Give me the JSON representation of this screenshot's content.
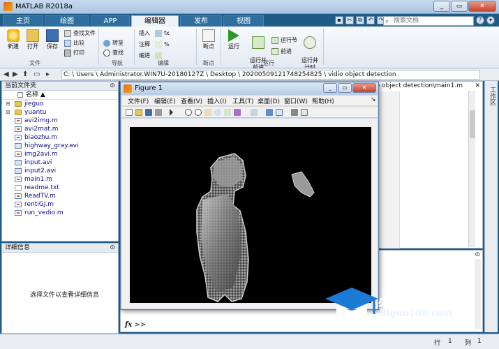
{
  "window": {
    "title": "MATLAB R2018a"
  },
  "tabs": [
    {
      "label": "主页"
    },
    {
      "label": "绘图"
    },
    {
      "label": "APP"
    },
    {
      "label": "编辑器"
    },
    {
      "label": "发布"
    },
    {
      "label": "视图"
    }
  ],
  "search": {
    "placeholder": "搜索文档"
  },
  "ribbon": {
    "new": "新建",
    "open": "打开",
    "save": "保存",
    "find_files": "查找文件",
    "compare": "比较",
    "print": "打印",
    "goto": "转至",
    "find": "查找",
    "insert": "插入",
    "comment": "注释",
    "indent": "缩进",
    "breakpoints": "断点",
    "run": "运行",
    "run_advance": "运行并\n前进",
    "run_section": "运行节",
    "advance": "前进",
    "run_time": "运行并\n计时",
    "group_file": "文件",
    "group_nav": "导航",
    "group_edit": "编辑",
    "group_bp": "断点",
    "group_run": "运行"
  },
  "address": {
    "path": "C: \\ Users \\ Administrator.WIN7U-20180127Z \\ Desktop \\ 20200509121748254825 \\ vidio object  detection"
  },
  "current_folder": {
    "title": "当前文件夹",
    "column": "名称 ▲",
    "files": [
      {
        "name": "jieguo",
        "type": "folder"
      },
      {
        "name": "yuantu",
        "type": "folder"
      },
      {
        "name": "avi2img.m",
        "type": "m"
      },
      {
        "name": "avi2mat.m",
        "type": "m"
      },
      {
        "name": "biaozhu.m",
        "type": "m"
      },
      {
        "name": "highway_gray.avi",
        "type": "avi"
      },
      {
        "name": "img2avi.m",
        "type": "m"
      },
      {
        "name": "input.avi",
        "type": "avi"
      },
      {
        "name": "input2.avi",
        "type": "avi"
      },
      {
        "name": "main1.m",
        "type": "m"
      },
      {
        "name": "readme.txt",
        "type": "txt"
      },
      {
        "name": "ReadTV.m",
        "type": "m"
      },
      {
        "name": "rentiGJ.m",
        "type": "m"
      },
      {
        "name": "run_vedio.m",
        "type": "m"
      }
    ]
  },
  "details": {
    "title": "详细信息",
    "hint": "选择文件以查看详细信息"
  },
  "editor": {
    "tab_path": "o object  detection\\main1.m"
  },
  "command": {
    "prompt": ">>"
  },
  "status": {
    "row_label": "行",
    "row_val": "1",
    "col_label": "列",
    "col_val": "1"
  },
  "figure": {
    "title": "Figure 1",
    "menu": [
      "文件(F)",
      "编辑(E)",
      "查看(V)",
      "插入(I)",
      "工具(T)",
      "桌面(D)",
      "窗口(W)",
      "帮助(H)"
    ]
  },
  "watermark": {
    "text": "必过源码",
    "sub": "Biguo100.com"
  },
  "colors": {
    "tab_active": "#eef2f7",
    "chrome": "#1e5b87",
    "axes_bg": "#000000"
  }
}
